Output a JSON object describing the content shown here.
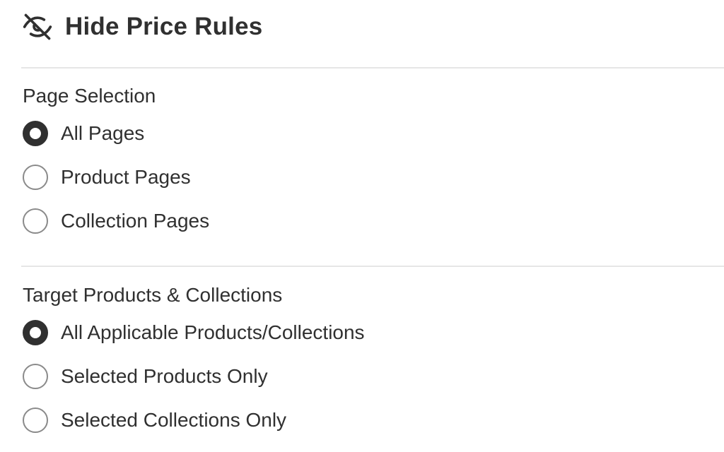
{
  "header": {
    "title": "Hide Price Rules",
    "icon": "eye-slash-icon"
  },
  "page_selection": {
    "title": "Page Selection",
    "options": [
      {
        "label": "All Pages",
        "checked": true
      },
      {
        "label": "Product Pages",
        "checked": false
      },
      {
        "label": "Collection Pages",
        "checked": false
      }
    ]
  },
  "target_selection": {
    "title": "Target Products & Collections",
    "options": [
      {
        "label": "All Applicable Products/Collections",
        "checked": true
      },
      {
        "label": "Selected Products Only",
        "checked": false
      },
      {
        "label": "Selected Collections Only",
        "checked": false
      }
    ]
  },
  "colors": {
    "text": "#303030",
    "radio_border": "#8a8a8a",
    "divider": "#e6e6e6"
  }
}
